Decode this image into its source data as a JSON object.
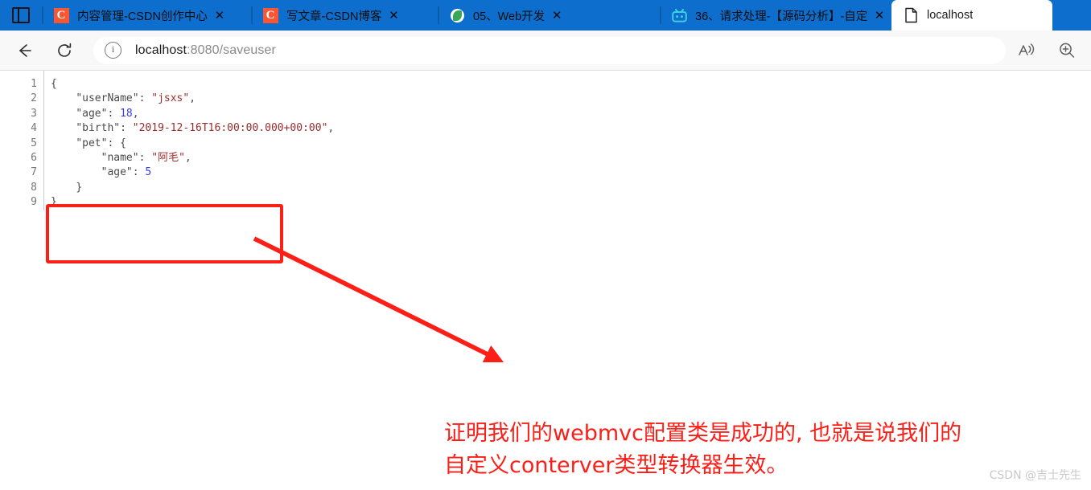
{
  "browser": {
    "tab_list_button": "tab-list",
    "tabs": [
      {
        "title": "内容管理-CSDN创作中心",
        "favicon": "csdn-icon",
        "close": "✕",
        "active": false,
        "width_class": "tab-w1"
      },
      {
        "title": "写文章-CSDN博客",
        "favicon": "csdn-icon",
        "close": "✕",
        "active": false,
        "width_class": "tab-w2"
      },
      {
        "title": "05、Web开发",
        "favicon": "leaf-icon",
        "close": "✕",
        "active": false,
        "width_class": "tab-w3"
      },
      {
        "title": "36、请求处理-【源码分析】-自定",
        "favicon": "bilibili-icon",
        "close": "✕",
        "active": false,
        "width_class": "tab-w4"
      },
      {
        "title": "localhost",
        "favicon": "document-icon",
        "close": "",
        "active": true,
        "width_class": "tab-w5"
      }
    ],
    "toolbar": {
      "back_label": "back-arrow",
      "reload_label": "reload-arrow",
      "info_label": "i",
      "url_host": "localhost",
      "url_rest": ":8080/saveuser",
      "url_full": "localhost:8080/saveuser",
      "read_aloud_label": "read-aloud",
      "zoom_label": "zoom"
    }
  },
  "page": {
    "line_numbers": [
      "1",
      "2",
      "3",
      "4",
      "5",
      "6",
      "7",
      "8",
      "9"
    ],
    "json_lines": [
      {
        "indent": "",
        "tokens": [
          {
            "t": "{",
            "c": "p"
          }
        ]
      },
      {
        "indent": "    ",
        "tokens": [
          {
            "t": "\"userName\"",
            "c": "k"
          },
          {
            "t": ": ",
            "c": "p"
          },
          {
            "t": "\"jsxs\"",
            "c": "s"
          },
          {
            "t": ",",
            "c": "p"
          }
        ]
      },
      {
        "indent": "    ",
        "tokens": [
          {
            "t": "\"age\"",
            "c": "k"
          },
          {
            "t": ": ",
            "c": "p"
          },
          {
            "t": "18",
            "c": "n"
          },
          {
            "t": ",",
            "c": "p"
          }
        ]
      },
      {
        "indent": "    ",
        "tokens": [
          {
            "t": "\"birth\"",
            "c": "k"
          },
          {
            "t": ": ",
            "c": "p"
          },
          {
            "t": "\"2019-12-16T16:00:00.000+00:00\"",
            "c": "s"
          },
          {
            "t": ",",
            "c": "p"
          }
        ]
      },
      {
        "indent": "    ",
        "tokens": [
          {
            "t": "\"pet\"",
            "c": "k"
          },
          {
            "t": ": ",
            "c": "p"
          },
          {
            "t": "{",
            "c": "p"
          }
        ]
      },
      {
        "indent": "        ",
        "tokens": [
          {
            "t": "\"name\"",
            "c": "k"
          },
          {
            "t": ": ",
            "c": "p"
          },
          {
            "t": "\"阿毛\"",
            "c": "s"
          },
          {
            "t": ",",
            "c": "p"
          }
        ]
      },
      {
        "indent": "        ",
        "tokens": [
          {
            "t": "\"age\"",
            "c": "k"
          },
          {
            "t": ": ",
            "c": "p"
          },
          {
            "t": "5",
            "c": "n"
          }
        ]
      },
      {
        "indent": "    ",
        "tokens": [
          {
            "t": "}",
            "c": "p"
          }
        ]
      },
      {
        "indent": "",
        "tokens": [
          {
            "t": "}",
            "c": "p"
          }
        ]
      }
    ],
    "raw_json": "{\n    \"userName\": \"jsxs\",\n    \"age\": 18,\n    \"birth\": \"2019-12-16T16:00:00.000+00:00\",\n    \"pet\": {\n        \"name\": \"阿毛\",\n        \"age\": 5\n    }\n}"
  },
  "annotations": {
    "highlight_box_name": "pet-object-highlight",
    "arrow_name": "pointer-arrow",
    "note_line1": "证明我们的webmvc配置类是成功的, 也就是说我们的",
    "note_line2": "自定义conterver类型转换器生效。",
    "color_red": "#fb1f18"
  },
  "watermark": "CSDN @吉士先生"
}
